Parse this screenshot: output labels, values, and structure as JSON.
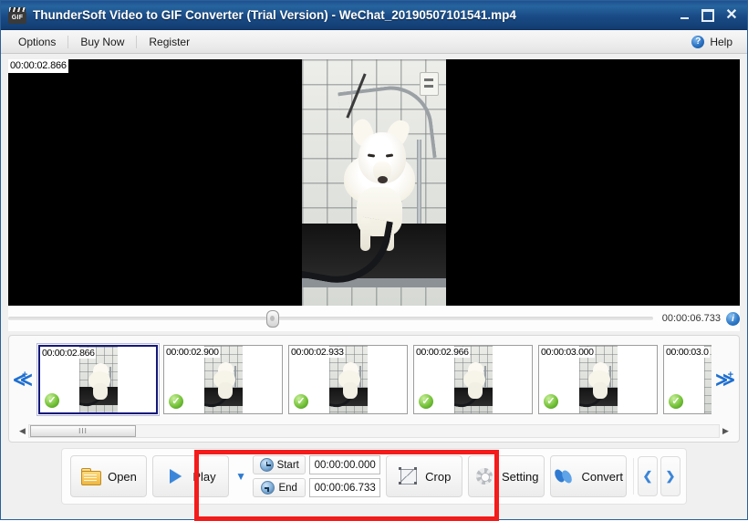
{
  "window": {
    "title": "ThunderSoft Video to GIF Converter (Trial Version) - WeChat_20190507101541.mp4",
    "app_icon_label": "GIF",
    "minimize_label": "",
    "maximize_label": "",
    "close_label": "✕"
  },
  "menubar": {
    "items": [
      {
        "label": "Options"
      },
      {
        "label": "Buy Now"
      },
      {
        "label": "Register"
      }
    ],
    "help_label": "Help",
    "help_icon_glyph": "?"
  },
  "preview": {
    "current_time_overlay": "00:00:02.866"
  },
  "seek": {
    "total_time": "00:00:06.733",
    "info_icon_glyph": "i",
    "thumb_position_percent": 40
  },
  "filmstrip": {
    "prev_arrow_glyph": "≪",
    "prev_plus_glyph": "+",
    "next_arrow_glyph": "≫",
    "next_plus_glyph": "+",
    "check_glyph": "✓",
    "frames": [
      {
        "time": "00:00:02.866",
        "selected": true
      },
      {
        "time": "00:00:02.900",
        "selected": false
      },
      {
        "time": "00:00:02.933",
        "selected": false
      },
      {
        "time": "00:00:02.966",
        "selected": false
      },
      {
        "time": "00:00:03.000",
        "selected": false
      },
      {
        "time": "00:00:03.0",
        "selected": false
      }
    ],
    "scroll_left_glyph": "◀",
    "scroll_right_glyph": "▶",
    "scroll_grip_glyph": "III"
  },
  "toolbar": {
    "open_label": "Open",
    "play_label": "Play",
    "play_dropdown_glyph": "▼",
    "start_label": "Start",
    "start_value": "00:00:00.000",
    "end_label": "End",
    "end_value": "00:00:06.733",
    "crop_label": "Crop",
    "setting_label": "Setting",
    "convert_label": "Convert",
    "prev_page_glyph": "❮",
    "next_page_glyph": "❯"
  },
  "highlight": {
    "color": "#f41b1b"
  }
}
